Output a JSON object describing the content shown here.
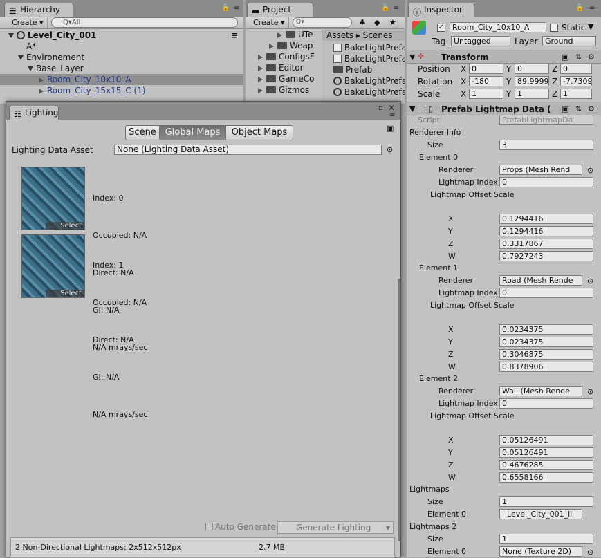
{
  "hierarchy": {
    "tab": "Hierarchy",
    "create": "Create ▾",
    "search": "Q▾All",
    "scene": "Level_City_001",
    "items": [
      "A*",
      "Environement",
      "Base_Layer",
      "Room_City_10x10_A",
      "Room_City_15x15_C (1)"
    ]
  },
  "project": {
    "tab": "Project",
    "create": "Create ▾",
    "breadcrumb": [
      "Assets",
      "Scenes"
    ],
    "folders": [
      "UTe",
      "Weap",
      "ConfigsF",
      "Editor",
      "GameCo",
      "Gizmos"
    ],
    "files": [
      "BakeLightPrefa",
      "BakeLightPrefa",
      "Prefab",
      "BakeLightPrefa",
      "BakeLightPrefa"
    ]
  },
  "lighting": {
    "tab": "Lighting",
    "tabs": [
      "Scene",
      "Global Maps",
      "Object Maps"
    ],
    "asset_label": "Lighting Data Asset",
    "asset_value": "None (Lighting Data Asset)",
    "maps": [
      {
        "index": "Index: 0",
        "occupied": "Occupied: N/A",
        "direct": "Direct: N/A",
        "gi": "GI: N/A",
        "rays": "N/A mrays/sec",
        "select": "Select"
      },
      {
        "index": "Index: 1",
        "occupied": "Occupied: N/A",
        "direct": "Direct: N/A",
        "gi": "GI: N/A",
        "rays": "N/A mrays/sec",
        "select": "Select"
      }
    ],
    "auto_generate": "Auto Generate",
    "generate": "Generate Lighting",
    "status": "2 Non-Directional Lightmaps: 2x512x512px",
    "size": "2.7 MB"
  },
  "inspector": {
    "tab": "Inspector",
    "name": "Room_City_10x10_A",
    "static": "Static",
    "tag_label": "Tag",
    "tag": "Untagged",
    "layer_label": "Layer",
    "layer": "Ground",
    "transform": {
      "title": "Transform",
      "position": [
        "0",
        "0",
        "0"
      ],
      "rotation": [
        "-180",
        "89.9999",
        "-7.7309"
      ],
      "scale": [
        "1",
        "1",
        "1"
      ],
      "labels": [
        "Position",
        "Rotation",
        "Scale"
      ]
    },
    "component": {
      "title": "Prefab Lightmap Data (",
      "script_label": "Script",
      "script": "PrefabLightmapDa",
      "renderer_info": "Renderer Info",
      "size_label": "Size",
      "size": "3",
      "renderer_label": "Renderer",
      "index_label": "Lightmap Index",
      "offset_label": "Lightmap Offset Scale",
      "elements": [
        {
          "name": "Element 0",
          "renderer": "Props (Mesh Rend",
          "index": "0",
          "xyzw": [
            "0.1294416",
            "0.1294416",
            "0.3317867",
            "0.7927243"
          ]
        },
        {
          "name": "Element 1",
          "renderer": "Road (Mesh Rende",
          "index": "0",
          "xyzw": [
            "0.0234375",
            "0.0234375",
            "0.3046875",
            "0.8378906"
          ]
        },
        {
          "name": "Element 2",
          "renderer": "Wall (Mesh Rende",
          "index": "0",
          "xyzw": [
            "0.05126491",
            "0.05126491",
            "0.4676285",
            "0.6558166"
          ]
        }
      ],
      "lightmaps": "Lightmaps",
      "lm_size": "1",
      "lm_el": "Element 0",
      "lm_val": "Level_City_001_li",
      "lightmaps2": "Lightmaps 2",
      "lm2_size": "1",
      "lm2_el": "Element 0",
      "lm2_val": "None (Texture 2D)"
    }
  }
}
